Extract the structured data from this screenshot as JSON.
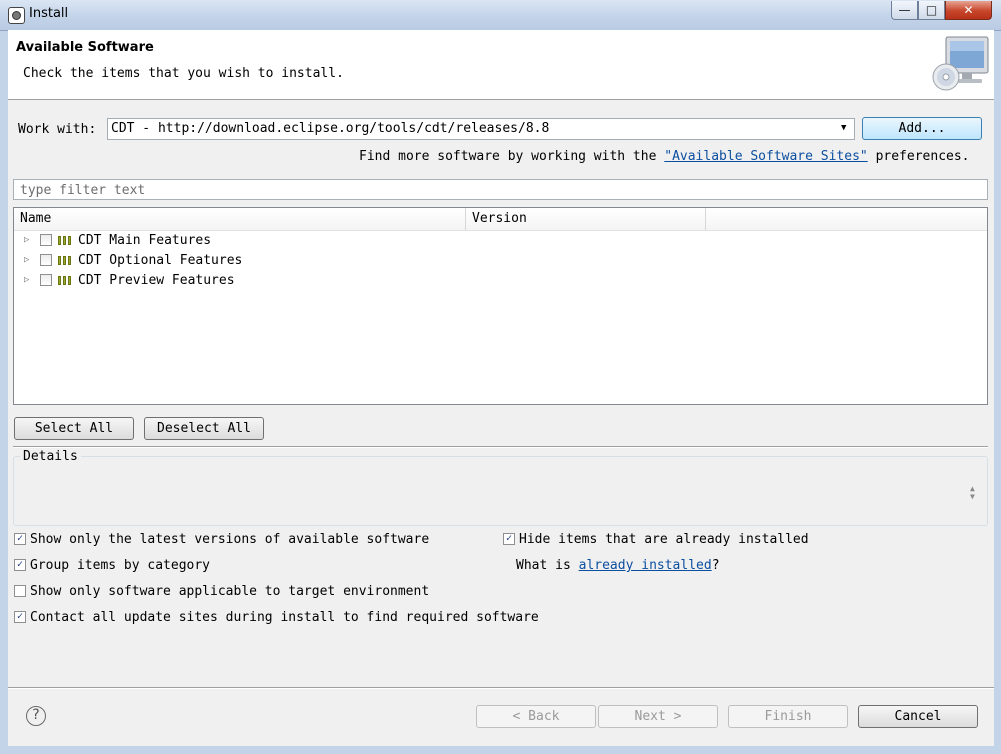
{
  "window": {
    "title": "Install",
    "min_glyph": "—",
    "max_glyph": "□",
    "close_glyph": "✕"
  },
  "header": {
    "title": "Available Software",
    "description": "Check the items that you wish to install."
  },
  "work_with": {
    "label": "Work with:",
    "value": "CDT - http://download.eclipse.org/tools/cdt/releases/8.8",
    "add_button": "Add...",
    "find_more_prefix": "Find more software by working with the ",
    "find_more_link": "\"Available Software Sites\"",
    "find_more_suffix": " preferences."
  },
  "filter": {
    "placeholder": "type filter text"
  },
  "tree": {
    "columns": [
      "Name",
      "Version"
    ],
    "items": [
      {
        "name": "CDT Main Features",
        "version": "",
        "checked": false
      },
      {
        "name": "CDT Optional Features",
        "version": "",
        "checked": false
      },
      {
        "name": "CDT Preview Features",
        "version": "",
        "checked": false
      }
    ]
  },
  "selection_buttons": {
    "select_all": "Select All",
    "deselect_all": "Deselect All"
  },
  "details": {
    "label": "Details"
  },
  "options": {
    "latest_only": {
      "label": "Show only the latest versions of available software",
      "checked": true
    },
    "hide_installed": {
      "label": "Hide items that are already installed",
      "checked": true
    },
    "group_by_category": {
      "label": "Group items by category",
      "checked": true
    },
    "what_is_prefix": "What is ",
    "what_is_link": "already installed",
    "what_is_suffix": "?",
    "target_env": {
      "label": "Show only software applicable to target environment",
      "checked": false
    },
    "contact_sites": {
      "label": "Contact all update sites during install to find required software",
      "checked": true
    }
  },
  "footer": {
    "help_glyph": "?",
    "back": "< Back",
    "next": "Next >",
    "finish": "Finish",
    "cancel": "Cancel"
  },
  "colors": {
    "link": "#0b4fa0",
    "package_icon": "#9aa82a",
    "default_button": "#bee6fd"
  },
  "icons": [
    "eclipse-app-icon",
    "install-monitor-cd-icon",
    "expand-triangle-icon",
    "package-feature-icon",
    "help-icon"
  ]
}
